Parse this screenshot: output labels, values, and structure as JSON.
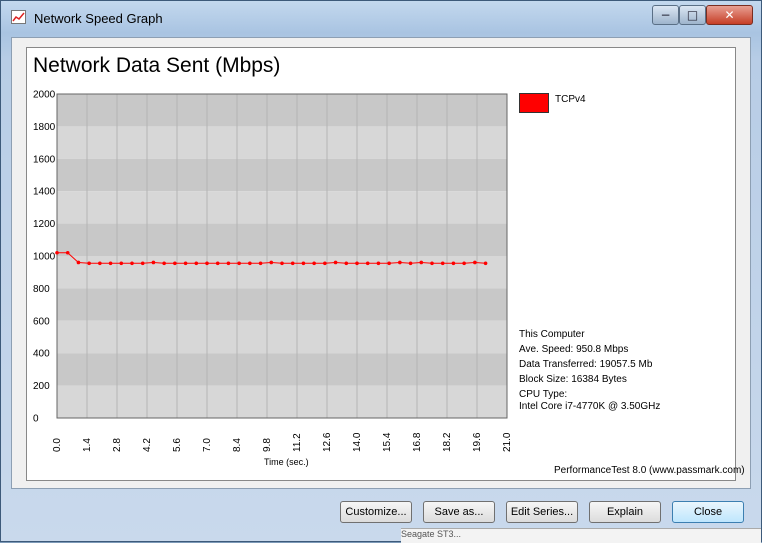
{
  "window": {
    "title": "Network Speed Graph",
    "controls": {
      "minimize": "−",
      "maximize": "□",
      "close": "✕"
    }
  },
  "colors": {
    "series": "#ff0000",
    "plot_band_dark": "#c8c8c8",
    "plot_band_light": "#d7d7d7"
  },
  "chart_data": {
    "type": "line",
    "title": "Network Data Sent (Mbps)",
    "xlabel": "Time (sec.)",
    "ylabel": "",
    "xlim": [
      0,
      21
    ],
    "ylim": [
      0,
      2000
    ],
    "x_ticks": [
      "0.0",
      "1.4",
      "2.8",
      "4.2",
      "5.6",
      "7.0",
      "8.4",
      "9.8",
      "11.2",
      "12.6",
      "14.0",
      "15.4",
      "16.8",
      "18.2",
      "19.6",
      "21.0"
    ],
    "y_ticks": [
      "2000",
      "1800",
      "1600",
      "1400",
      "1200",
      "1000",
      "800",
      "600",
      "400",
      "200",
      "0"
    ],
    "grid": true,
    "legend_position": "right",
    "series": [
      {
        "name": "TCPv4",
        "color": "#ff0000",
        "x": [
          0.0,
          0.5,
          1.0,
          1.5,
          2.0,
          2.5,
          3.0,
          3.5,
          4.0,
          4.5,
          5.0,
          5.5,
          6.0,
          6.5,
          7.0,
          7.5,
          8.0,
          8.5,
          9.0,
          9.5,
          10.0,
          10.5,
          11.0,
          11.5,
          12.0,
          12.5,
          13.0,
          13.5,
          14.0,
          14.5,
          15.0,
          15.5,
          16.0,
          16.5,
          17.0,
          17.5,
          18.0,
          18.5,
          19.0,
          19.5,
          20.0
        ],
        "y": [
          1020,
          1020,
          960,
          955,
          955,
          955,
          955,
          955,
          955,
          960,
          955,
          955,
          955,
          955,
          955,
          955,
          955,
          955,
          955,
          955,
          960,
          955,
          955,
          955,
          955,
          955,
          960,
          955,
          955,
          955,
          955,
          955,
          960,
          955,
          960,
          955,
          955,
          955,
          955,
          960,
          955
        ]
      }
    ]
  },
  "info": {
    "heading": "This Computer",
    "ave_speed": "Ave. Speed: 950.8 Mbps",
    "data_transferred": "Data Transferred: 19057.5 Mb",
    "block_size": "Block Size: 16384 Bytes",
    "cpu_type_label": "CPU Type:",
    "cpu": "Intel Core i7-4770K @ 3.50GHz"
  },
  "credit": "PerformanceTest 8.0 (www.passmark.com)",
  "buttons": {
    "customize": "Customize...",
    "save_as": "Save as...",
    "edit_series": "Edit Series...",
    "explain": "Explain",
    "close": "Close"
  },
  "background_text": "Seagate ST3..."
}
